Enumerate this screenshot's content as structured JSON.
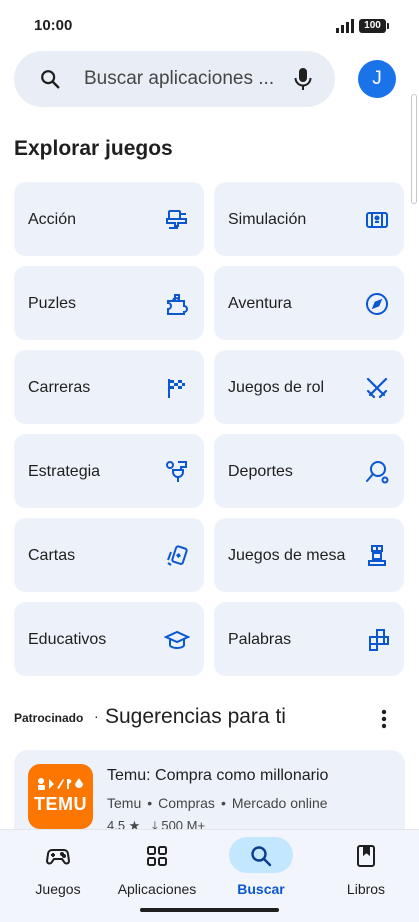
{
  "status_bar": {
    "time": "10:00",
    "battery": "100"
  },
  "search": {
    "placeholder": "Buscar aplicaciones ...",
    "avatar_initial": "J"
  },
  "explore": {
    "title": "Explorar juegos",
    "categories": [
      {
        "label": "Acción",
        "icon": "action-icon"
      },
      {
        "label": "Simulación",
        "icon": "simulation-icon"
      },
      {
        "label": "Puzles",
        "icon": "puzzle-icon"
      },
      {
        "label": "Aventura",
        "icon": "compass-icon"
      },
      {
        "label": "Carreras",
        "icon": "checkered-flag-icon"
      },
      {
        "label": "Juegos de rol",
        "icon": "crossed-swords-icon"
      },
      {
        "label": "Estrategia",
        "icon": "strategy-icon"
      },
      {
        "label": "Deportes",
        "icon": "sports-icon"
      },
      {
        "label": "Cartas",
        "icon": "cards-icon"
      },
      {
        "label": "Juegos de mesa",
        "icon": "board-game-icon"
      },
      {
        "label": "Educativos",
        "icon": "graduation-cap-icon"
      },
      {
        "label": "Palabras",
        "icon": "word-tiles-icon"
      }
    ]
  },
  "suggestions": {
    "sponsored_label": "Patrocinado",
    "separator": "·",
    "title": "Sugerencias para ti",
    "app": {
      "logo_text": "TEMU",
      "name": "Temu: Compra como millonario",
      "developer": "Temu",
      "category": "Compras",
      "tag": "Mercado online",
      "meta_separator": "•",
      "rating": "4,5 ★",
      "downloads": "500 M+"
    }
  },
  "bottom_nav": {
    "items": [
      {
        "label": "Juegos",
        "icon": "gamepad-icon",
        "active": false
      },
      {
        "label": "Aplicaciones",
        "icon": "apps-grid-icon",
        "active": false
      },
      {
        "label": "Buscar",
        "icon": "search-icon",
        "active": true
      },
      {
        "label": "Libros",
        "icon": "book-icon",
        "active": false
      }
    ]
  },
  "colors": {
    "accent": "#0b57d0",
    "tile_background": "#edf2fa",
    "active_pill": "#c2e7ff",
    "temu_orange": "#fb7701",
    "avatar": "#1a73e8"
  }
}
